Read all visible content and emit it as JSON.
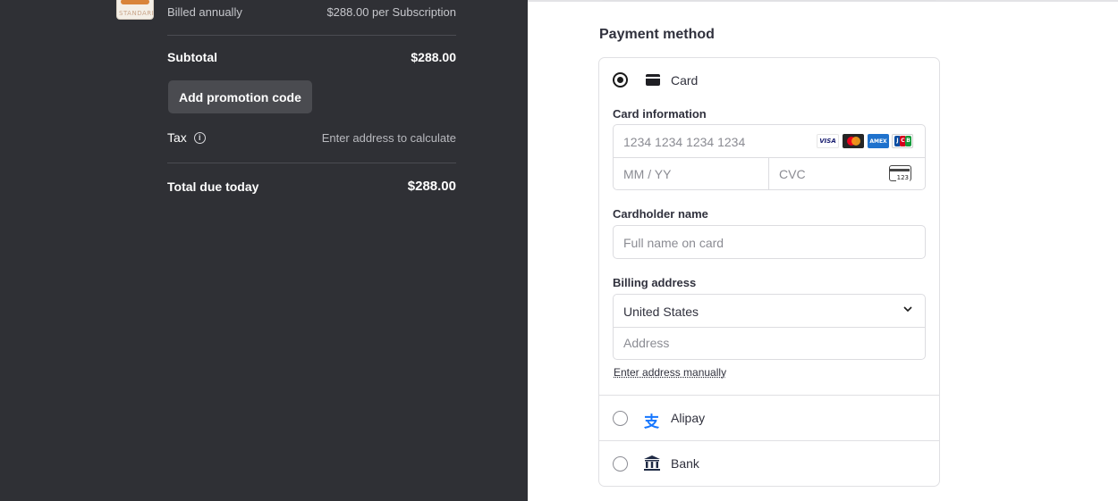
{
  "summary": {
    "product_thumb_text": "STANDARD",
    "billed": "Billed annually",
    "billed_price": "$288.00 per Subscription",
    "subtotal_label": "Subtotal",
    "subtotal_value": "$288.00",
    "promo_button": "Add promotion code",
    "tax_label": "Tax",
    "tax_hint": "Enter address to calculate",
    "total_label": "Total due today",
    "total_value": "$288.00"
  },
  "payment": {
    "heading": "Payment method",
    "methods": [
      {
        "label": "Card",
        "selected": true,
        "icon": "credit-card-icon"
      },
      {
        "label": "Alipay",
        "selected": false,
        "icon": "alipay-icon"
      },
      {
        "label": "Bank",
        "selected": false,
        "icon": "bank-icon"
      }
    ],
    "card_info_label": "Card information",
    "card_number_placeholder": "1234 1234 1234 1234",
    "expiry_placeholder": "MM / YY",
    "cvc_placeholder": "CVC",
    "cvc_icon_text": "123",
    "card_brands": [
      "VISA",
      "Mastercard",
      "American Express",
      "JCB"
    ],
    "cardholder_label": "Cardholder name",
    "cardholder_placeholder": "Full name on card",
    "billing_label": "Billing address",
    "country_value": "United States",
    "address_placeholder": "Address",
    "manual_link": "Enter address manually"
  },
  "colors": {
    "left_panel_bg": "#2f3035",
    "alipay_blue": "#1677ff",
    "text_dark": "#30313d"
  }
}
